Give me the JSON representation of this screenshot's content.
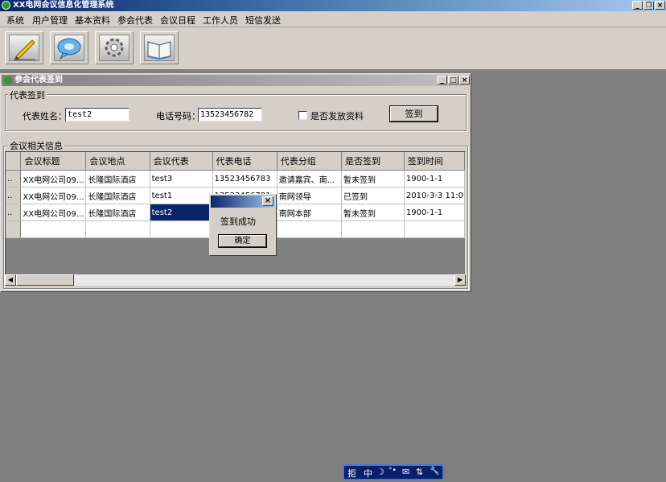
{
  "app": {
    "title": "XX电网会议信息化管理系统"
  },
  "window_buttons": {
    "minimize": "_",
    "restore": "❐",
    "close": "×"
  },
  "menu": [
    "系统",
    "用户管理",
    "基本资料",
    "参会代表",
    "会议日程",
    "工作人员",
    "短信发送"
  ],
  "toolbar": {
    "buttons": [
      {
        "icon": "pencil-icon"
      },
      {
        "icon": "chat-bubble-icon"
      },
      {
        "icon": "gear-icon"
      },
      {
        "icon": "book-icon"
      }
    ]
  },
  "child_window": {
    "title": "参会代表签到",
    "signin_group": {
      "label": "代表签到",
      "name_label": "代表姓名：",
      "name_value": "test2",
      "phone_label": "电话号码：",
      "phone_value": "13523456782",
      "material_label": "是否发放资料",
      "material_checked": false,
      "signin_button": "签到"
    },
    "info_group": {
      "label": "会议相关信息",
      "columns": [
        "会议标题",
        "会议地点",
        "会议代表",
        "代表电话",
        "代表分组",
        "是否签到",
        "签到时间"
      ],
      "rows": [
        {
          "indicator": "..",
          "cells": [
            "XX电网公司09...",
            "长隆国际酒店",
            "test3",
            "13523456783",
            "邀请嘉宾、南...",
            "暂未签到",
            "1900-1-1"
          ]
        },
        {
          "indicator": "..",
          "cells": [
            "XX电网公司09...",
            "长隆国际酒店",
            "test1",
            "13523456781",
            "南网领导",
            "已签到",
            "2010-3-3 11:0"
          ]
        },
        {
          "indicator": "..",
          "cells": [
            "XX电网公司09...",
            "长隆国际酒店",
            "test2",
            "",
            "南网本部",
            "暂未签到",
            "1900-1-1"
          ]
        }
      ]
    }
  },
  "dialog": {
    "message": "签到成功",
    "ok_button": "确定",
    "close": "×"
  },
  "language_bar": [
    "拒",
    "中",
    "☽",
    "°•",
    "✉",
    "⇅",
    "🔧"
  ]
}
